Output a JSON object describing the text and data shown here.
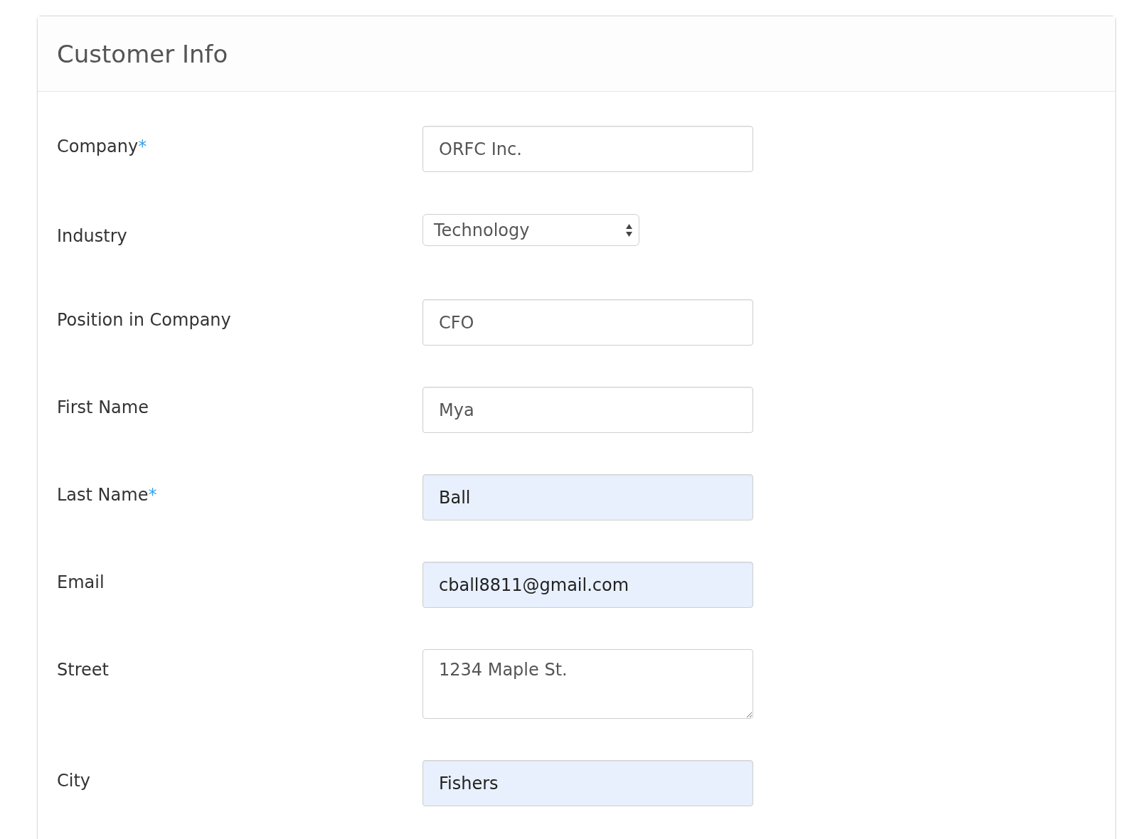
{
  "card": {
    "title": "Customer Info"
  },
  "fields": [
    {
      "kind": "text",
      "label": "Company",
      "required_mark": "*",
      "value": "ORFC Inc.",
      "autofilled": false
    },
    {
      "kind": "select",
      "label": "Industry",
      "value": "Technology",
      "autofilled": false
    },
    {
      "kind": "text",
      "label": "Position in Company",
      "value": "CFO",
      "autofilled": false
    },
    {
      "kind": "text",
      "label": "First Name",
      "value": "Mya",
      "autofilled": false
    },
    {
      "kind": "text",
      "label": "Last Name",
      "required_mark": "*",
      "value": "Ball",
      "autofilled": true
    },
    {
      "kind": "text",
      "label": "Email",
      "value": "cball8811@gmail.com",
      "autofilled": true
    },
    {
      "kind": "textarea",
      "label": "Street",
      "value": "1234 Maple St.",
      "autofilled": false
    },
    {
      "kind": "text",
      "label": "City",
      "value": "Fishers",
      "autofilled": true
    }
  ]
}
